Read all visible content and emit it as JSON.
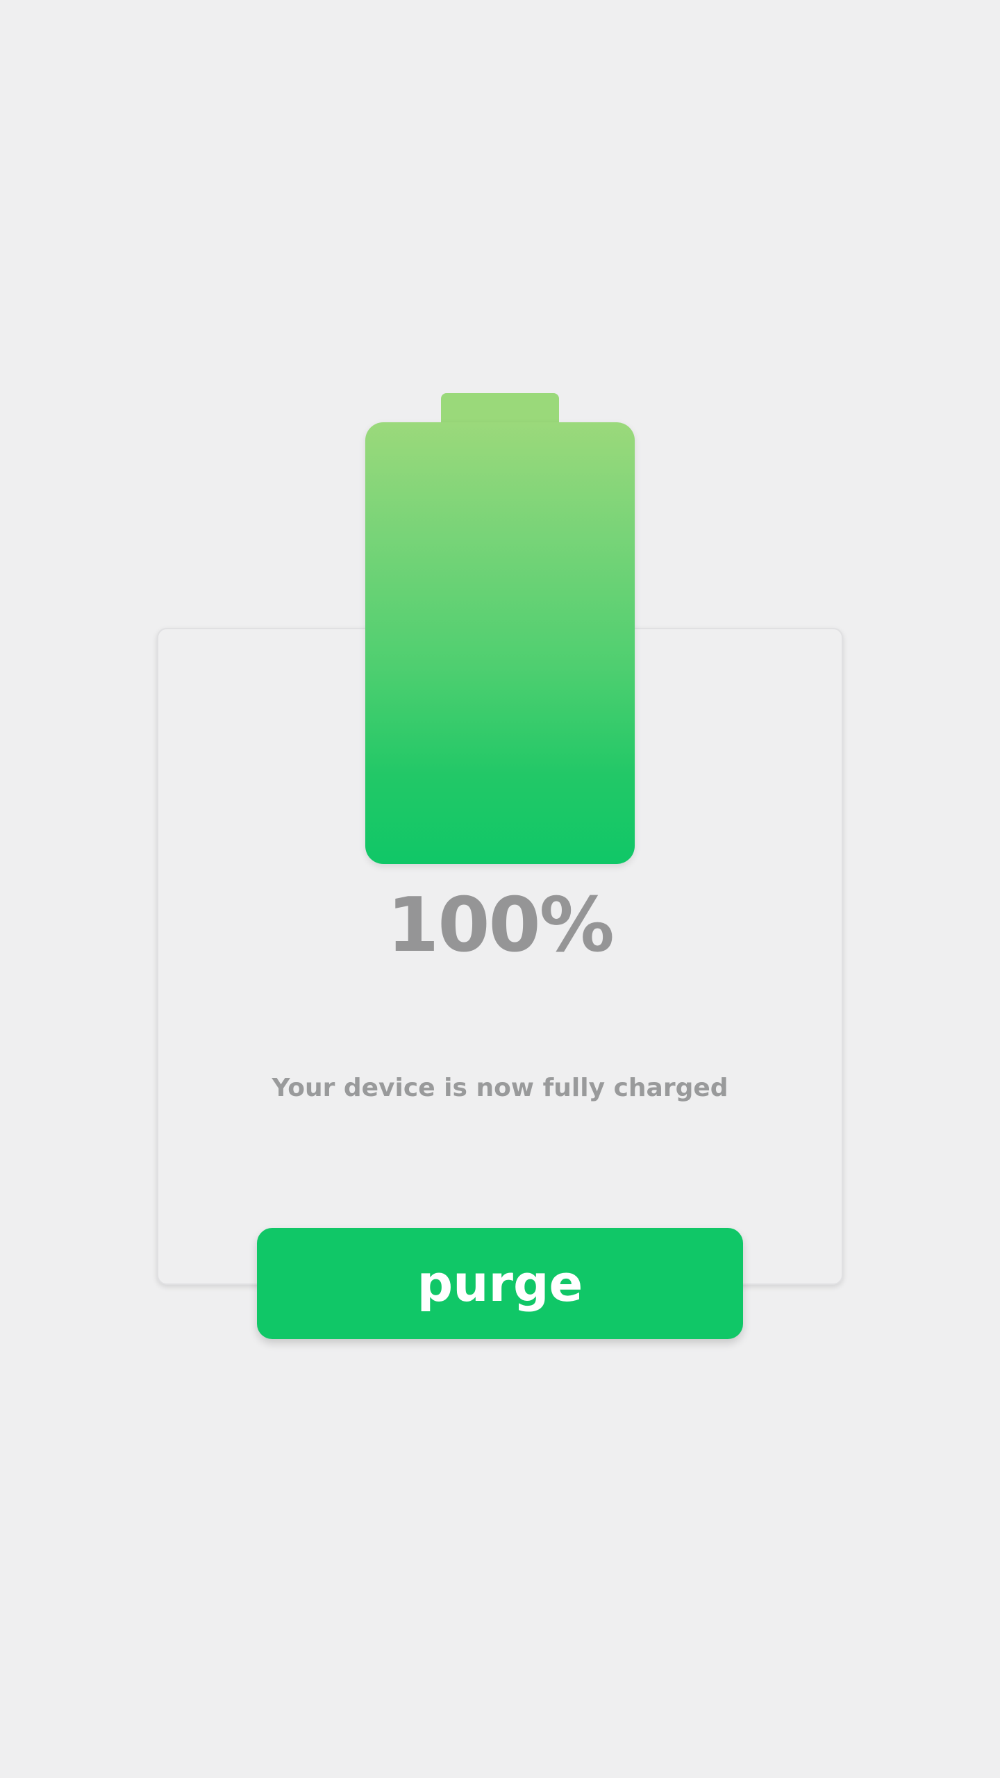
{
  "battery": {
    "level": 1.0,
    "percent_label": "100%",
    "gradient_top": "#9bd97b",
    "gradient_bottom": "#10c767"
  },
  "status": {
    "message": "Your device is now fully charged"
  },
  "actions": {
    "purge_label": "purge",
    "accent_color": "#10c767"
  }
}
